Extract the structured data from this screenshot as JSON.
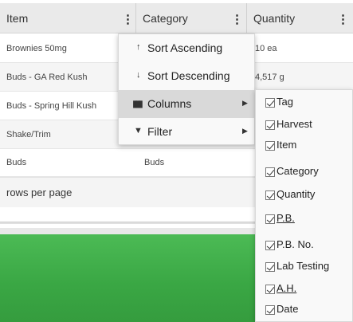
{
  "grid": {
    "headers": [
      {
        "label": "Item"
      },
      {
        "label": "Category"
      },
      {
        "label": "Quantity"
      }
    ],
    "rows": [
      {
        "item": "Brownies 50mg",
        "category": "",
        "quantity": "10 ea"
      },
      {
        "item": "Buds - GA Red Kush",
        "category": "",
        "quantity": "4,517 g"
      },
      {
        "item": "Buds - Spring Hill Kush",
        "category": "",
        "quantity": ""
      },
      {
        "item": "Shake/Trim",
        "category": "",
        "quantity": ""
      },
      {
        "item": "Buds",
        "category": "Buds",
        "quantity": ""
      }
    ],
    "rows_per_page_label": "rows per page"
  },
  "column_menu": {
    "items": [
      {
        "label": "Sort Ascending",
        "icon": "arrow-up-icon",
        "glyph": "↑"
      },
      {
        "label": "Sort Descending",
        "icon": "arrow-down-icon",
        "glyph": "↓"
      },
      {
        "label": "Columns",
        "icon": "columns-icon",
        "glyph": "▮▮▮",
        "submenu": true
      },
      {
        "label": "Filter",
        "icon": "filter-icon",
        "glyph": "▼",
        "submenu": true
      }
    ]
  },
  "columns_submenu": {
    "items": [
      {
        "label": "Tag",
        "checked": true
      },
      {
        "label": "Harvest",
        "checked": true
      },
      {
        "label": "Item",
        "checked": true
      },
      {
        "label": "Category",
        "checked": true
      },
      {
        "label": "Quantity",
        "checked": true
      },
      {
        "label": "P.B.",
        "checked": true
      },
      {
        "label": "P.B. No.",
        "checked": true
      },
      {
        "label": "Lab Testing",
        "checked": true
      },
      {
        "label": "A.H.",
        "checked": true
      },
      {
        "label": "Date",
        "checked": true
      }
    ]
  },
  "colors": {
    "header_bg": "#eaeaea",
    "menu_bg": "#f9f9f9",
    "active_item_bg": "#d9d9d9",
    "green": "#3aa744"
  }
}
